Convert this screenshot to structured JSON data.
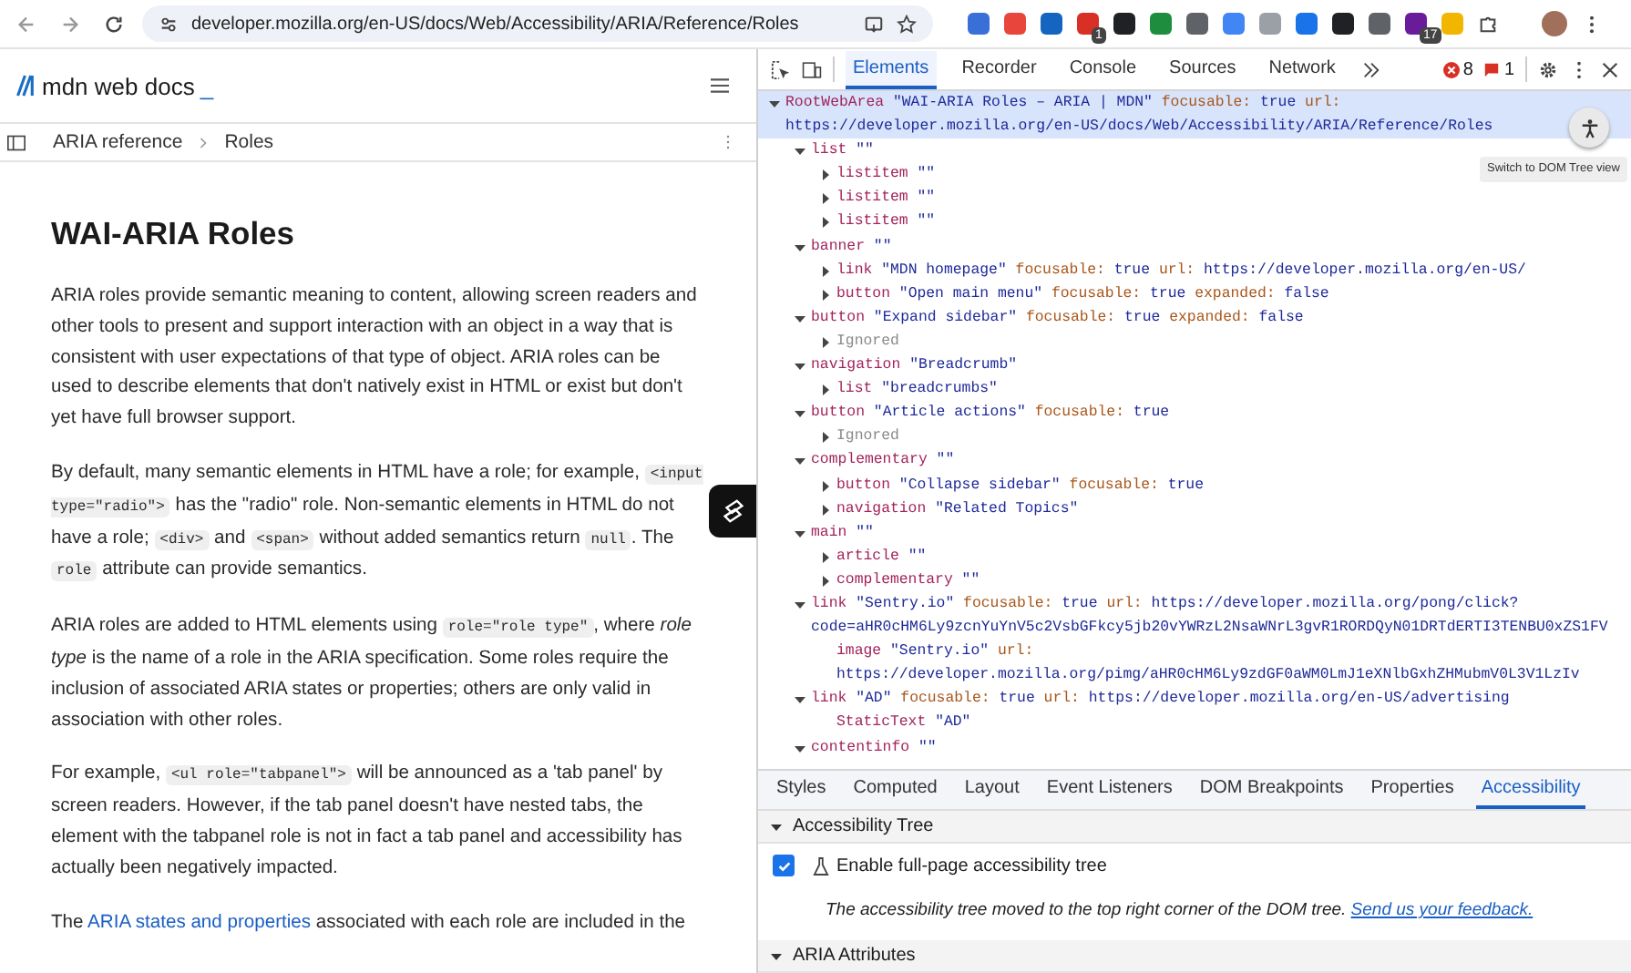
{
  "browser": {
    "url": "developer.mozilla.org/en-US/docs/Web/Accessibility/ARIA/Reference/Roles",
    "extensions": [
      {
        "color": "#3b6fd8"
      },
      {
        "color": "#e8453c"
      },
      {
        "color": "#1565c0"
      },
      {
        "color": "#d93025",
        "badge": "1"
      },
      {
        "color": "#202124"
      },
      {
        "color": "#1e8e3e"
      },
      {
        "color": "#5f6368"
      },
      {
        "color": "#4285f4"
      },
      {
        "color": "#9aa0a6"
      },
      {
        "color": "#1a73e8"
      },
      {
        "color": "#202124"
      },
      {
        "color": "#5f6368"
      },
      {
        "color": "#6a1b9a",
        "badge": "17"
      },
      {
        "color": "#f2b600"
      }
    ]
  },
  "site": {
    "logo": "mdn web docs",
    "logo_cursor": "_",
    "breadcrumbs": [
      "ARIA reference",
      "Roles"
    ]
  },
  "article": {
    "title": "WAI-ARIA Roles",
    "paragraphs": [
      [
        {
          "kind": "text",
          "text": "ARIA roles provide semantic meaning to content, allowing screen readers and other tools to present and support interaction with an object in a way that is consistent with user expectations of that type of object. ARIA roles can be used to describe elements that don't natively exist in HTML or exist but don't yet have full browser support."
        }
      ],
      [
        {
          "kind": "text",
          "text": "By default, many semantic elements in HTML have a role; for example, "
        },
        {
          "kind": "code",
          "text": "<input type=\"radio\">"
        },
        {
          "kind": "text",
          "text": " has the \"radio\" role. Non-semantic elements in HTML do not have a role; "
        },
        {
          "kind": "code",
          "text": "<div>"
        },
        {
          "kind": "text",
          "text": " and "
        },
        {
          "kind": "code",
          "text": "<span>"
        },
        {
          "kind": "text",
          "text": " without added semantics return "
        },
        {
          "kind": "code",
          "text": "null"
        },
        {
          "kind": "text",
          "text": ". The "
        },
        {
          "kind": "code",
          "text": "role"
        },
        {
          "kind": "text",
          "text": " attribute can provide semantics."
        }
      ],
      [
        {
          "kind": "text",
          "text": "ARIA roles are added to HTML elements using "
        },
        {
          "kind": "code",
          "text": "role=\"role type\""
        },
        {
          "kind": "text",
          "text": ", where "
        },
        {
          "kind": "em",
          "text": "role type"
        },
        {
          "kind": "text",
          "text": " is the name of a role in the ARIA specification. Some roles require the inclusion of associated ARIA states or properties; others are only valid in association with other roles."
        }
      ],
      [
        {
          "kind": "text",
          "text": "For example, "
        },
        {
          "kind": "code",
          "text": "<ul role=\"tabpanel\">"
        },
        {
          "kind": "text",
          "text": " will be announced as a 'tab panel' by screen readers. However, if the tab panel doesn't have nested tabs, the element with the tabpanel role is not in fact a tab panel and accessibility has actually been negatively impacted."
        }
      ],
      [
        {
          "kind": "text",
          "text": "The "
        },
        {
          "kind": "link",
          "text": "ARIA states and properties"
        },
        {
          "kind": "text",
          "text": " associated with each role are included in the"
        }
      ]
    ]
  },
  "devtools": {
    "tabs": [
      {
        "label": "Elements",
        "selected": true
      },
      {
        "label": "Recorder",
        "selected": false
      },
      {
        "label": "Console",
        "selected": false
      },
      {
        "label": "Sources",
        "selected": false
      },
      {
        "label": "Network",
        "selected": false
      }
    ],
    "errors": "8",
    "issues": "1",
    "tooltip": "Switch to DOM Tree view",
    "tree": [
      {
        "kind": "node",
        "role": "RootWebArea",
        "name": "\"WAI-ARIA Roles – ARIA | MDN\"",
        "props": [
          {
            "key": "focusable:",
            "value": "true"
          },
          {
            "key": "url:",
            "value": "https://developer.mozilla.org/en-US/docs/Web/Accessibility/ARIA/Reference/Roles"
          }
        ],
        "expanded": true,
        "selected": true,
        "children": [
          {
            "kind": "node",
            "role": "list",
            "name": "\"\"",
            "expanded": true,
            "selected": false,
            "children": [
              {
                "kind": "node",
                "role": "listitem",
                "name": "\"\"",
                "expanded": false,
                "selected": false
              },
              {
                "kind": "node",
                "role": "listitem",
                "name": "\"\"",
                "expanded": false,
                "selected": false
              },
              {
                "kind": "node",
                "role": "listitem",
                "name": "\"\"",
                "expanded": false,
                "selected": false
              }
            ]
          },
          {
            "kind": "node",
            "role": "banner",
            "name": "\"\"",
            "expanded": true,
            "selected": false,
            "children": [
              {
                "kind": "node",
                "role": "link",
                "name": "\"MDN homepage\"",
                "props": [
                  {
                    "key": "focusable:",
                    "value": "true"
                  },
                  {
                    "key": "url:",
                    "value": "https://developer.mozilla.org/en-US/"
                  }
                ],
                "expanded": false,
                "selected": false
              },
              {
                "kind": "node",
                "role": "button",
                "name": "\"Open main menu\"",
                "props": [
                  {
                    "key": "focusable:",
                    "value": "true"
                  },
                  {
                    "key": "expanded:",
                    "value": "false"
                  }
                ],
                "expanded": false,
                "selected": false
              }
            ]
          },
          {
            "kind": "node",
            "role": "button",
            "name": "\"Expand sidebar\"",
            "props": [
              {
                "key": "focusable:",
                "value": "true"
              },
              {
                "key": "expanded:",
                "value": "false"
              }
            ],
            "expanded": true,
            "selected": false,
            "children": [
              {
                "kind": "ignored",
                "role": "Ignored",
                "expanded": false,
                "selected": false
              }
            ]
          },
          {
            "kind": "node",
            "role": "navigation",
            "name": "\"Breadcrumb\"",
            "expanded": true,
            "selected": false,
            "children": [
              {
                "kind": "node",
                "role": "list",
                "name": "\"breadcrumbs\"",
                "expanded": false,
                "selected": false
              }
            ]
          },
          {
            "kind": "node",
            "role": "button",
            "name": "\"Article actions\"",
            "props": [
              {
                "key": "focusable:",
                "value": "true"
              }
            ],
            "expanded": true,
            "selected": false,
            "children": [
              {
                "kind": "ignored",
                "role": "Ignored",
                "expanded": false,
                "selected": false
              }
            ]
          },
          {
            "kind": "node",
            "role": "complementary",
            "name": "\"\"",
            "expanded": true,
            "selected": false,
            "children": [
              {
                "kind": "node",
                "role": "button",
                "name": "\"Collapse sidebar\"",
                "props": [
                  {
                    "key": "focusable:",
                    "value": "true"
                  }
                ],
                "expanded": false,
                "selected": false
              },
              {
                "kind": "node",
                "role": "navigation",
                "name": "\"Related Topics\"",
                "expanded": false,
                "selected": false
              }
            ]
          },
          {
            "kind": "node",
            "role": "main",
            "name": "\"\"",
            "expanded": true,
            "selected": false,
            "children": [
              {
                "kind": "node",
                "role": "article",
                "name": "\"\"",
                "expanded": false,
                "selected": false
              },
              {
                "kind": "node",
                "role": "complementary",
                "name": "\"\"",
                "expanded": false,
                "selected": false
              }
            ]
          },
          {
            "kind": "node",
            "role": "link",
            "name": "\"Sentry.io\"",
            "props": [
              {
                "key": "focusable:",
                "value": "true"
              },
              {
                "key": "url:",
                "value": "https://developer.mozilla.org/pong/click?code=aHR0cHM6Ly9zcnYuYnV5c2VsbGFkcy5jb20vYWRzL2NsaWNrL3gvR1RORDQyN01DRTdERTI3TENBU0xZS1FV"
              }
            ],
            "expanded": true,
            "selected": false,
            "children": [
              {
                "kind": "leaf",
                "role": "image",
                "name": "\"Sentry.io\"",
                "props": [
                  {
                    "key": "url:",
                    "value": "https://developer.mozilla.org/pimg/aHR0cHM6Ly9zdGF0aWM0LmJ1eXNlbGxhZHMubmV0L3V1LzIv"
                  }
                ],
                "selected": false
              }
            ]
          },
          {
            "kind": "node",
            "role": "link",
            "name": "\"AD\"",
            "props": [
              {
                "key": "focusable:",
                "value": "true"
              },
              {
                "key": "url:",
                "value": "https://developer.mozilla.org/en-US/advertising"
              }
            ],
            "expanded": true,
            "selected": false,
            "children": [
              {
                "kind": "leaf",
                "role": "StaticText",
                "name": "\"AD\"",
                "selected": false
              }
            ]
          },
          {
            "kind": "node",
            "role": "contentinfo",
            "name": "\"\"",
            "expanded": true,
            "selected": false
          }
        ]
      }
    ],
    "panel_tabs": [
      {
        "label": "Styles",
        "selected": false
      },
      {
        "label": "Computed",
        "selected": false
      },
      {
        "label": "Layout",
        "selected": false
      },
      {
        "label": "Event Listeners",
        "selected": false
      },
      {
        "label": "DOM Breakpoints",
        "selected": false
      },
      {
        "label": "Properties",
        "selected": false
      },
      {
        "label": "Accessibility",
        "selected": true
      }
    ],
    "sections": [
      {
        "title": "Accessibility Tree",
        "expanded": true,
        "checkbox": {
          "label": "Enable full-page accessibility tree",
          "checked": true
        },
        "note": "The accessibility tree moved to the top right corner of the DOM tree.",
        "link": "Send us your feedback."
      },
      {
        "title": "ARIA Attributes",
        "expanded": true
      }
    ]
  }
}
